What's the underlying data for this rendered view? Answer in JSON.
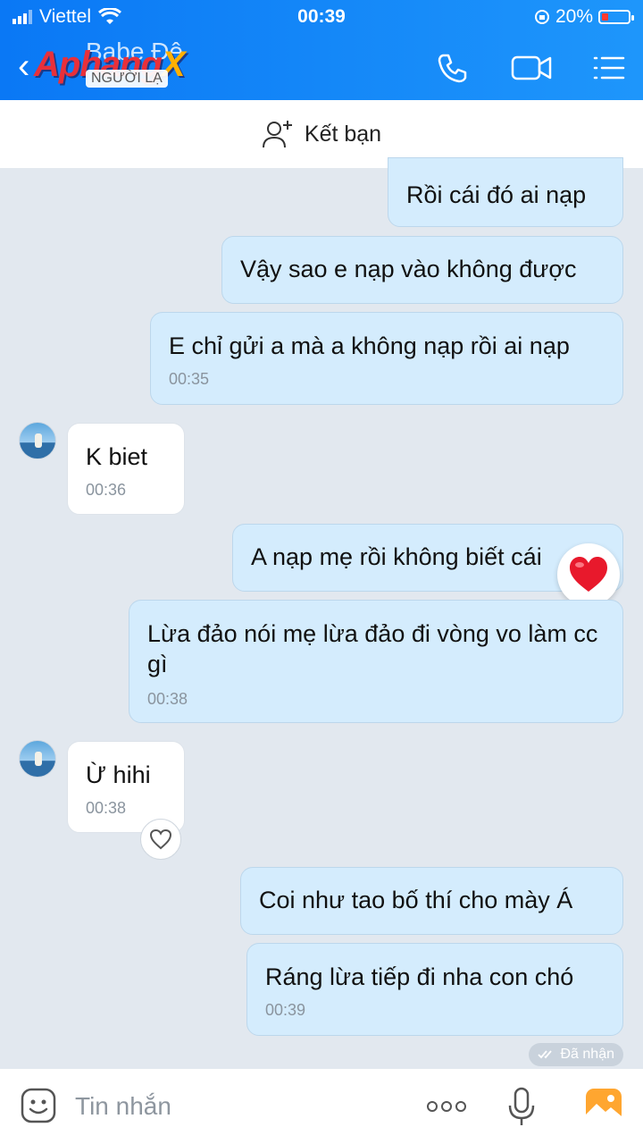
{
  "status_bar": {
    "carrier": "Viettel",
    "time": "00:39",
    "battery": "20%"
  },
  "header": {
    "contact_name": "Babe Đệ",
    "badge": "NGƯỜI LẠ",
    "watermark_main": "Aphang",
    "watermark_x": "X"
  },
  "add_friend": {
    "label": "Kết bạn"
  },
  "messages": [
    {
      "dir": "out",
      "text": "Rồi cái đó ai nạp",
      "time": ""
    },
    {
      "dir": "out",
      "text": "Vậy sao e nạp vào không được",
      "time": ""
    },
    {
      "dir": "out",
      "text": "E chỉ gửi a mà a không nạp rồi ai nạp",
      "time": "00:35"
    },
    {
      "dir": "in",
      "text": "K biet",
      "time": "00:36"
    },
    {
      "dir": "out",
      "text": "A nạp mẹ rồi không biết cái",
      "time": ""
    },
    {
      "dir": "out",
      "text": "Lừa đảo nói mẹ lừa đảo đi vòng vo làm cc gì",
      "time": "00:38"
    },
    {
      "dir": "in",
      "text": "Ừ hihi",
      "time": "00:38"
    },
    {
      "dir": "out",
      "text": "Coi như tao bố thí cho mày Á",
      "time": ""
    },
    {
      "dir": "out",
      "text": "Ráng lừa tiếp đi nha con chó",
      "time": "00:39"
    }
  ],
  "receipt": {
    "label": "Đã nhận"
  },
  "composer": {
    "placeholder": "Tin nhắn"
  },
  "colors": {
    "header": "#0a78f5",
    "outgoing_bubble": "#d4ecfd",
    "incoming_bubble": "#ffffff",
    "background": "#e2e8ef",
    "reaction_heart": "#e8192c"
  },
  "icons": [
    "back-arrow-icon",
    "phone-icon",
    "video-call-icon",
    "menu-icon",
    "add-user-icon",
    "heart-reaction-icon",
    "like-heart-icon",
    "double-check-icon",
    "emoji-icon",
    "more-icon",
    "microphone-icon",
    "image-icon"
  ]
}
